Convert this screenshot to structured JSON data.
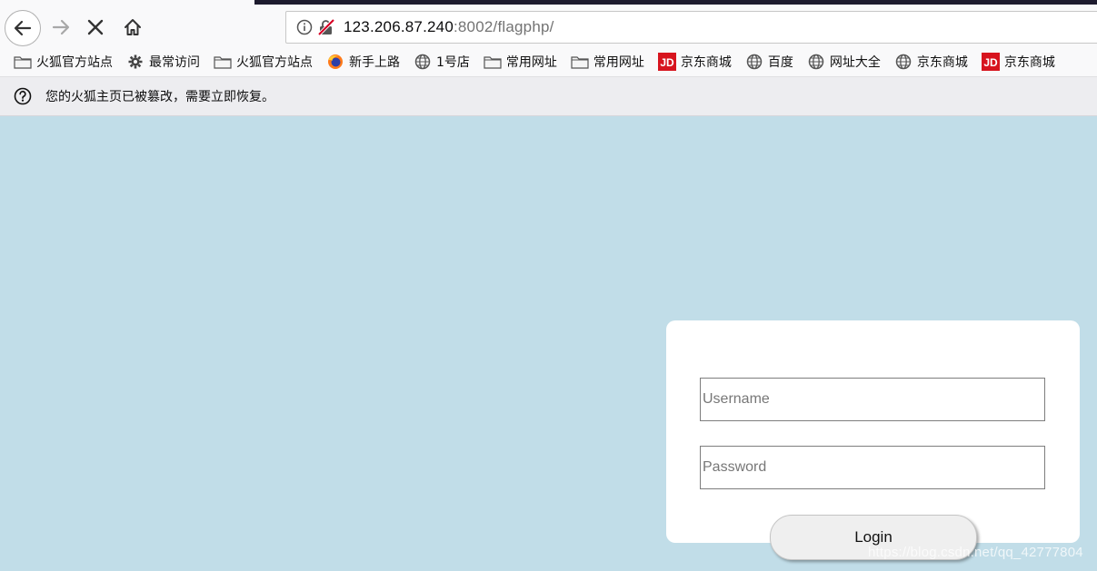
{
  "browser": {
    "address": {
      "host": "123.206.87.240",
      "rest": ":8002/flagphp/"
    },
    "bookmarks": [
      {
        "label": "火狐官方站点",
        "icon": "folder-icon"
      },
      {
        "label": "最常访问",
        "icon": "gear-icon"
      },
      {
        "label": "火狐官方站点",
        "icon": "folder-icon"
      },
      {
        "label": "新手上路",
        "icon": "firefox-icon"
      },
      {
        "label": "1号店",
        "icon": "globe-icon"
      },
      {
        "label": "常用网址",
        "icon": "folder-icon"
      },
      {
        "label": "常用网址",
        "icon": "folder-icon"
      },
      {
        "label": "京东商城",
        "icon": "jd-icon"
      },
      {
        "label": "百度",
        "icon": "globe-icon"
      },
      {
        "label": "网址大全",
        "icon": "globe-icon"
      },
      {
        "label": "京东商城",
        "icon": "globe-icon"
      },
      {
        "label": "京东商城",
        "icon": "jd-icon"
      }
    ],
    "jd_text": "JD",
    "notice": "您的火狐主页已被篡改，需要立即恢复。"
  },
  "login_form": {
    "username_placeholder": "Username",
    "password_placeholder": "Password",
    "login_label": "Login"
  },
  "watermark": "https://blog.csdn.net/qq_42777804",
  "colors": {
    "page_background": "#c1dde8",
    "card": "#ffffff",
    "jd_red": "#d7141e"
  }
}
